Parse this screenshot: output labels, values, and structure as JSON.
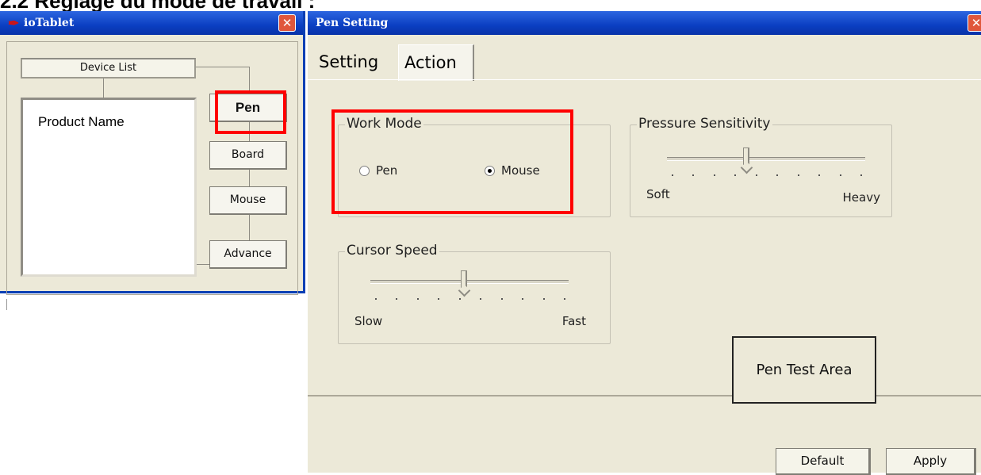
{
  "doc_heading": "2.2 Réglage du mode de travail :",
  "iotablet": {
    "title": "ioTablet",
    "icon": "pen-icon",
    "close_label": "✕",
    "device_list_header": "Device List",
    "device_items": [
      "Product Name"
    ],
    "buttons": {
      "pen": "Pen",
      "board": "Board",
      "mouse": "Mouse",
      "advance": "Advance"
    }
  },
  "pen_setting": {
    "title": "Pen Setting",
    "close_label": "✕",
    "tabs": [
      {
        "label": "Setting",
        "active": false
      },
      {
        "label": "Action",
        "active": true
      }
    ],
    "work_mode": {
      "title": "Work Mode",
      "options": [
        "Pen",
        "Mouse"
      ],
      "selected": "Mouse"
    },
    "pressure_sensitivity": {
      "title": "Pressure Sensitivity",
      "min_label": "Soft",
      "max_label": "Heavy",
      "value_fraction": 0.4
    },
    "cursor_speed": {
      "title": "Cursor Speed",
      "min_label": "Slow",
      "max_label": "Fast",
      "value_fraction": 0.47
    },
    "pen_test_area": "Pen Test Area",
    "footer": {
      "default_label": "Default",
      "apply_label": "Apply"
    }
  },
  "colors": {
    "highlight_box": "#ff0000",
    "titlebar": "#0b3fc2",
    "window_bg": "#ece9d8"
  }
}
